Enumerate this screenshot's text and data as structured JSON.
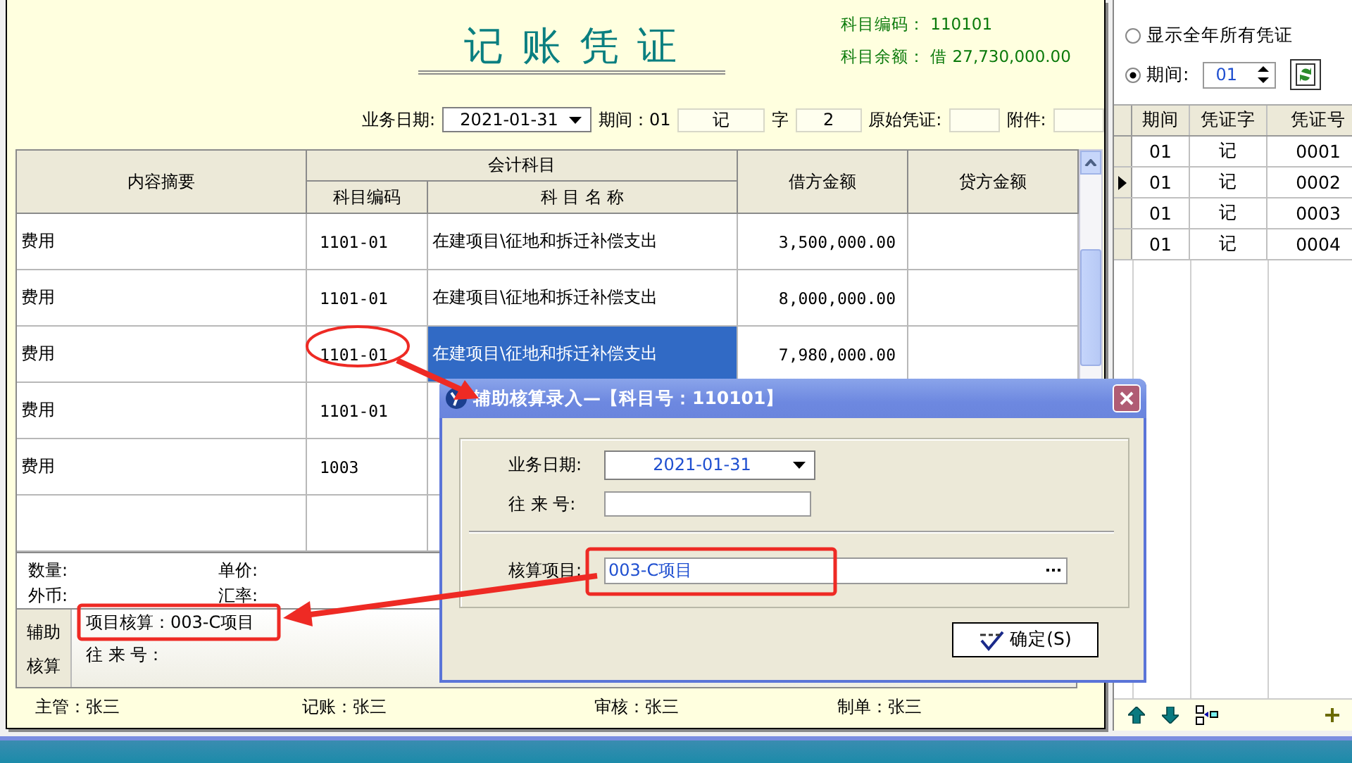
{
  "voucher": {
    "title": "记 账 凭 证",
    "subject_code_label": "科目编码：",
    "subject_code": "110101",
    "balance_label": "科目余额：",
    "balance": "借 27,730,000.00",
    "date_label": "业务日期:",
    "date": "2021-01-31",
    "period_label": "期间：01",
    "voucher_type": "记",
    "type_suffix": "字",
    "voucher_no": "2",
    "source_label": "原始凭证:",
    "attach_label": "附件:"
  },
  "table": {
    "headers": {
      "summary": "内容摘要",
      "account_group": "会计科目",
      "account_code": "科目编码",
      "account_name": "科 目 名 称",
      "debit": "借方金额",
      "credit": "贷方金额"
    },
    "rows": [
      {
        "summary": "费用",
        "code": "1101-01",
        "name": "在建项目\\征地和拆迁补偿支出",
        "debit": "3,500,000.00",
        "selected": false
      },
      {
        "summary": "费用",
        "code": "1101-01",
        "name": "在建项目\\征地和拆迁补偿支出",
        "debit": "8,000,000.00",
        "selected": false
      },
      {
        "summary": "费用",
        "code": "1101-01",
        "name": "在建项目\\征地和拆迁补偿支出",
        "debit": "7,980,000.00",
        "selected": true
      },
      {
        "summary": "费用",
        "code": "1101-01",
        "selected": false
      },
      {
        "summary": "费用",
        "code": "1003",
        "selected": false
      }
    ]
  },
  "details": {
    "quantity_label": "数量:",
    "price_label": "单价:",
    "currency_label": "外币:",
    "rate_label": "汇率:"
  },
  "auxiliary": {
    "label_lines": [
      "辅助",
      "核算"
    ],
    "project": "项目核算：003-C项目",
    "contact_label": "往 来 号："
  },
  "signatures": [
    "主管：张三",
    "记账：张三",
    "审核：张三",
    "制单：张三"
  ],
  "side_panel": {
    "options": [
      {
        "label": "显示全年所有凭证",
        "selected": false
      },
      {
        "label": "期间:",
        "selected": true
      }
    ],
    "period": "01",
    "columns": [
      "期间",
      "凭证字",
      "凭证号"
    ],
    "rows": [
      {
        "period": "01",
        "type": "记",
        "no": "0001",
        "selected": false
      },
      {
        "period": "01",
        "type": "记",
        "no": "0002",
        "selected": true
      },
      {
        "period": "01",
        "type": "记",
        "no": "0003",
        "selected": false
      },
      {
        "period": "01",
        "type": "记",
        "no": "0004",
        "selected": false
      }
    ]
  },
  "dialog": {
    "title": "辅助核算录入—【科目号：110101】",
    "date_label": "业务日期:",
    "date": "2021-01-31",
    "contact_label": "往 来 号:",
    "item_label": "核算项目:",
    "item": "003-C项目",
    "ok": "确定(S)"
  }
}
